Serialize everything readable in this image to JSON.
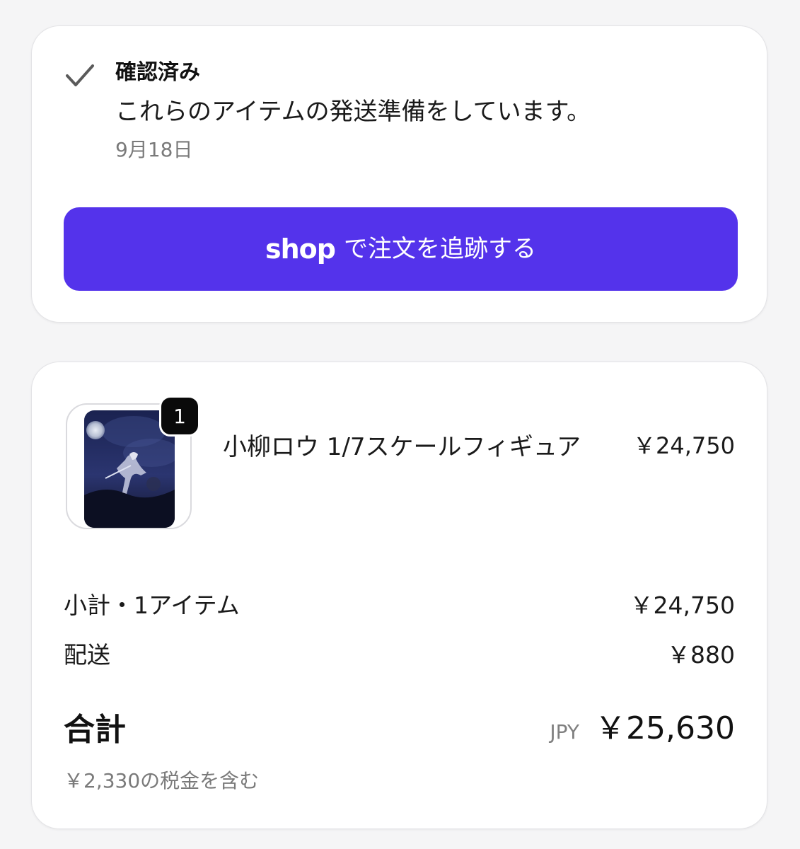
{
  "status": {
    "title": "確認済み",
    "message": "これらのアイテムの発送準備をしています。",
    "date": "9月18日",
    "track_button": {
      "logo": "shop",
      "label": "で注文を追跡する",
      "color": "#5433eb"
    },
    "icon": "check-icon"
  },
  "order": {
    "item": {
      "name": "小柳ロウ 1/7スケールフィギュア",
      "price": "￥24,750",
      "quantity": "1"
    },
    "subtotal": {
      "label": "小計・1アイテム",
      "value": "￥24,750"
    },
    "shipping": {
      "label": "配送",
      "value": "￥880"
    },
    "total": {
      "label": "合計",
      "currency": "JPY",
      "value": "￥25,630"
    },
    "tax_note": "￥2,330の税金を含む"
  }
}
